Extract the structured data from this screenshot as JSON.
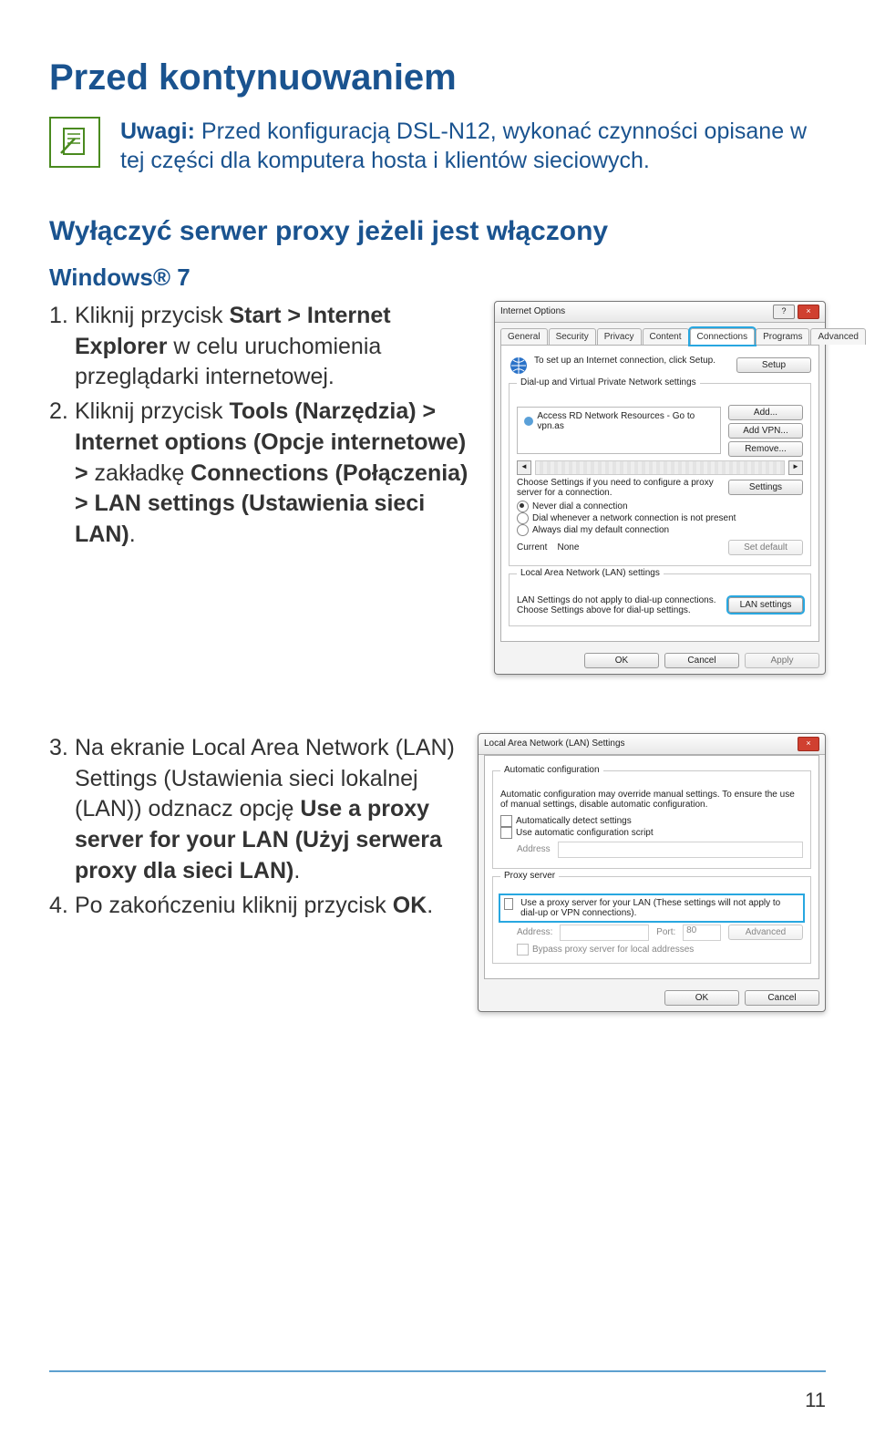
{
  "page_title": "Przed kontynuowaniem",
  "note": {
    "label": "Uwagi:",
    "text": "Przed konfiguracją DSL-N12, wykonać czynności opisane w tej części dla komputera hosta i klientów sieciowych."
  },
  "section_heading": "Wyłączyć serwer proxy jeżeli jest włączony",
  "subheading": "Windows® 7",
  "steps_a": [
    {
      "n": "1.",
      "parts": [
        "Kliknij przycisk ",
        {
          "b": "Start > Internet Explorer"
        },
        " w celu uruchomienia przeglądarki internetowej."
      ]
    },
    {
      "n": "2.",
      "parts": [
        "Kliknij przycisk ",
        {
          "b": "Tools (Narzędzia) > Internet options (Opcje internetowe) >"
        },
        " zakładkę ",
        {
          "b": "Connections (Połączenia) > LAN settings (Ustawienia sieci LAN)"
        },
        "."
      ]
    }
  ],
  "steps_b": [
    {
      "n": "3.",
      "parts": [
        "Na ekranie Local Area Network (LAN) Settings (Ustawienia sieci lokalnej (LAN)) odznacz opcję ",
        {
          "b": "Use a proxy server for your LAN (Użyj serwera proxy dla sieci LAN)"
        },
        "."
      ]
    },
    {
      "n": "4.",
      "parts": [
        "Po zakończeniu kliknij przycisk ",
        {
          "b": "OK"
        },
        "."
      ]
    }
  ],
  "page_number": "11",
  "dlg1": {
    "title": "Internet Options",
    "tabs": [
      "General",
      "Security",
      "Privacy",
      "Content",
      "Connections",
      "Programs",
      "Advanced"
    ],
    "setup_text": "To set up an Internet connection, click Setup.",
    "setup_btn": "Setup",
    "grp_dial": "Dial-up and Virtual Private Network settings",
    "dial_item": "Access RD Network Resources - Go to vpn.as",
    "btn_add": "Add...",
    "btn_addvpn": "Add VPN...",
    "btn_remove": "Remove...",
    "proxy_hint": "Choose Settings if you need to configure a proxy server for a connection.",
    "btn_settings": "Settings",
    "r1": "Never dial a connection",
    "r2": "Dial whenever a network connection is not present",
    "r3": "Always dial my default connection",
    "cur_label": "Current",
    "cur_val": "None",
    "btn_setdefault": "Set default",
    "grp_lan": "Local Area Network (LAN) settings",
    "lan_hint": "LAN Settings do not apply to dial-up connections. Choose Settings above for dial-up settings.",
    "btn_lansettings": "LAN settings",
    "ok": "OK",
    "cancel": "Cancel",
    "apply": "Apply"
  },
  "dlg2": {
    "title": "Local Area Network (LAN) Settings",
    "grp_auto": "Automatic configuration",
    "auto_hint": "Automatic configuration may override manual settings. To ensure the use of manual settings, disable automatic configuration.",
    "cb1": "Automatically detect settings",
    "cb2": "Use automatic configuration script",
    "addr_label": "Address",
    "grp_proxy": "Proxy server",
    "cb3": "Use a proxy server for your LAN (These settings will not apply to dial-up or VPN connections).",
    "addr2": "Address:",
    "port": "Port:",
    "port_val": "80",
    "adv": "Advanced",
    "bypass": "Bypass proxy server for local addresses",
    "ok": "OK",
    "cancel": "Cancel"
  }
}
